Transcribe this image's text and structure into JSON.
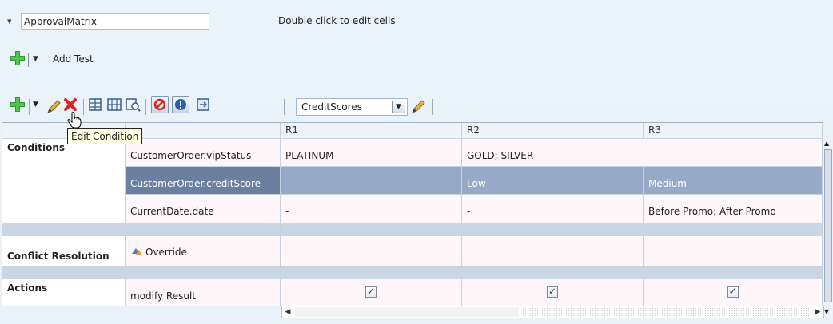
{
  "header": {
    "rule_name": "ApprovalMatrix",
    "hint": "Double click to edit cells",
    "add_test_label": "Add Test"
  },
  "toolbar": {
    "dropdown_value": "CreditScores",
    "tooltip": "Edit Condition"
  },
  "table": {
    "columns": [
      "R1",
      "R2",
      "R3"
    ],
    "conditions_label": "Conditions",
    "conditions": [
      {
        "name": "CustomerOrder.vipStatus",
        "r1": "PLATINUM",
        "r2": "GOLD; SILVER",
        "r3": ""
      },
      {
        "name": "CustomerOrder.creditScore",
        "r1": "-",
        "r2": "Low",
        "r3": "Medium"
      },
      {
        "name": "CurrentDate.date",
        "r1": "-",
        "r2": "-",
        "r3": "Before Promo; After Promo"
      }
    ],
    "conflict_label": "Conflict Resolution",
    "override_label": "Override",
    "actions_label": "Actions",
    "action_name": "modify Result"
  }
}
